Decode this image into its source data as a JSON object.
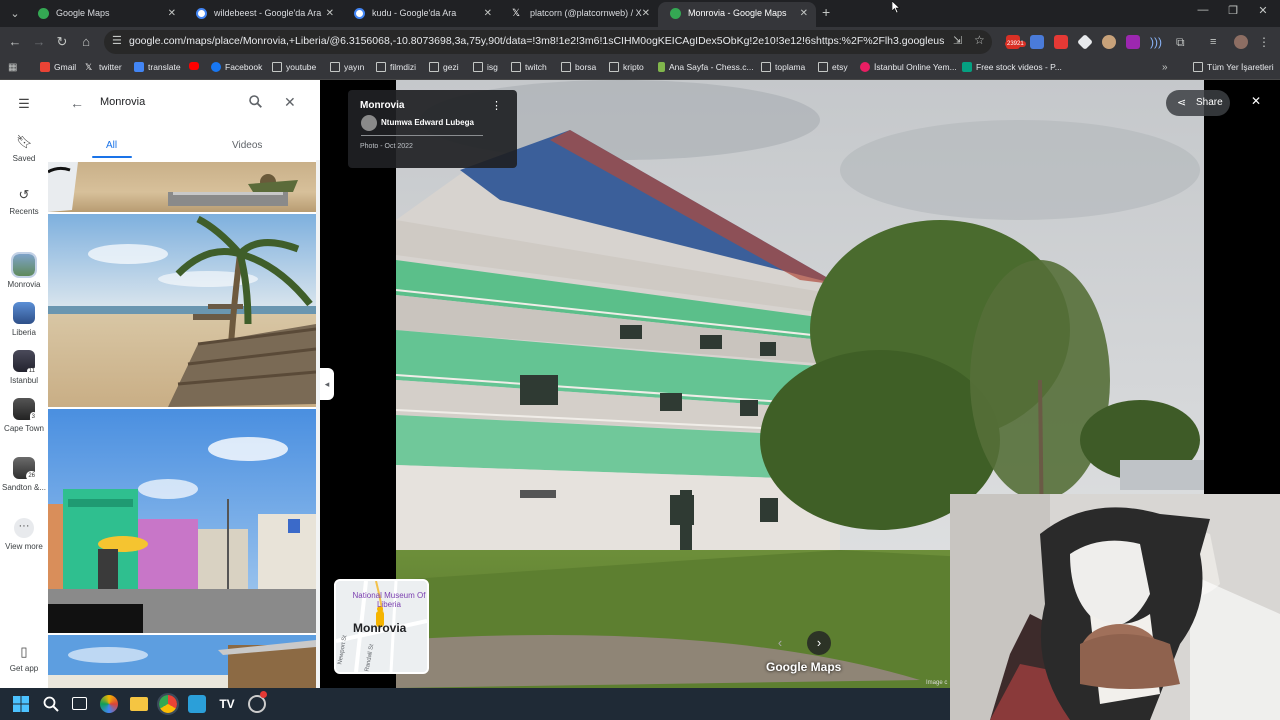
{
  "tabs": [
    {
      "title": "Google Maps",
      "favicon_color": "#34a853",
      "active": false
    },
    {
      "title": "wildebeest - Google'da Ara",
      "favicon_color": "#ffffff",
      "active": false
    },
    {
      "title": "kudu - Google'da Ara",
      "favicon_color": "#ffffff",
      "active": false
    },
    {
      "title": "platcorn (@platcornweb) / X",
      "favicon_color": "#000000",
      "active": false
    },
    {
      "title": "Monrovia - Google Maps",
      "favicon_color": "#34a853",
      "active": true
    }
  ],
  "url": "google.com/maps/place/Monrovia,+Liberia/@6.3156068,-10.8073698,3a,75y,90t/data=!3m8!1e2!3m6!1sCIHM0ogKEICAgIDex5ObKg!2e10!3e12!6shttps:%2F%2Flh3.googleusercontent.com%2Fgps-...",
  "extension_badge": "23921",
  "bookmarks": [
    {
      "label": "Gmail",
      "icon": "gmail-icon"
    },
    {
      "label": "twitter",
      "icon": "x-icon"
    },
    {
      "label": "translate",
      "icon": "translate-icon"
    },
    {
      "label": "",
      "icon": "youtube-icon"
    },
    {
      "label": "Facebook",
      "icon": "facebook-icon"
    },
    {
      "label": "youtube",
      "icon": "folder-icon"
    },
    {
      "label": "yayın",
      "icon": "folder-icon"
    },
    {
      "label": "filmdizi",
      "icon": "folder-icon"
    },
    {
      "label": "gezi",
      "icon": "folder-icon"
    },
    {
      "label": "isg",
      "icon": "folder-icon"
    },
    {
      "label": "twitch",
      "icon": "folder-icon"
    },
    {
      "label": "borsa",
      "icon": "folder-icon"
    },
    {
      "label": "kripto",
      "icon": "folder-icon"
    },
    {
      "label": "Ana Sayfa - Chess.c...",
      "icon": "chess-icon"
    },
    {
      "label": "toplama",
      "icon": "folder-icon"
    },
    {
      "label": "etsy",
      "icon": "folder-icon"
    },
    {
      "label": "İstanbul Online Yem...",
      "icon": "yemek-icon"
    },
    {
      "label": "Free stock videos - P...",
      "icon": "pexels-icon"
    }
  ],
  "all_bookmarks_label": "Tüm Yer İşaretleri",
  "rail": {
    "saved": "Saved",
    "recents": "Recents",
    "places": [
      {
        "label": "Monrovia",
        "badge": ""
      },
      {
        "label": "Liberia",
        "badge": ""
      },
      {
        "label": "Istanbul",
        "badge": "11"
      },
      {
        "label": "Cape Town",
        "badge": "3"
      },
      {
        "label": "Sandton &...",
        "badge": "26"
      }
    ],
    "view_more": "View more",
    "get_app": "Get app"
  },
  "search": {
    "query": "Monrovia"
  },
  "panel_tabs": {
    "all": "All",
    "videos": "Videos"
  },
  "photo_card": {
    "title": "Monrovia",
    "author": "Ntumwa Edward Lubega",
    "date": "Photo - Oct 2022"
  },
  "share_label": "Share",
  "minimap": {
    "poi": "National Museum Of Liberia",
    "city": "Monrovia",
    "street1": "Newport St",
    "street2": "Randall St"
  },
  "watermark": "Google Maps",
  "image_credit": "Image c"
}
